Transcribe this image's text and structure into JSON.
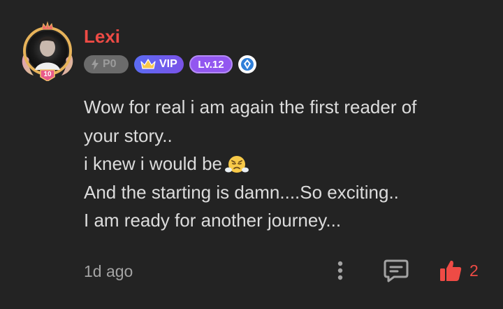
{
  "comment": {
    "username": "Lexi",
    "avatar_level": "10",
    "badges": {
      "power": "P0",
      "vip": "VIP",
      "level": "Lv.12"
    },
    "body_lines": [
      "Wow for real i am again the first reader of",
      "your story..",
      "i knew i would be",
      "And the starting is damn....So exciting..",
      "I am ready for another journey..."
    ],
    "emoji": "face-with-steam-from-nose-emoji",
    "time": "1d ago",
    "like_count": "2"
  },
  "icons": {
    "more": "more-vertical-icon",
    "reply": "comment-icon",
    "like": "thumbs-up-icon",
    "power": "lightning-icon",
    "vip": "crown-icon",
    "gem": "diamond-icon"
  },
  "colors": {
    "background": "#232323",
    "username": "#ee4b45",
    "body_text": "#dcdcdc",
    "meta_text": "#a3a3a3",
    "like": "#ee4b45",
    "vip_badge": "#5b6cf3",
    "level_badge": "#9257f0"
  }
}
